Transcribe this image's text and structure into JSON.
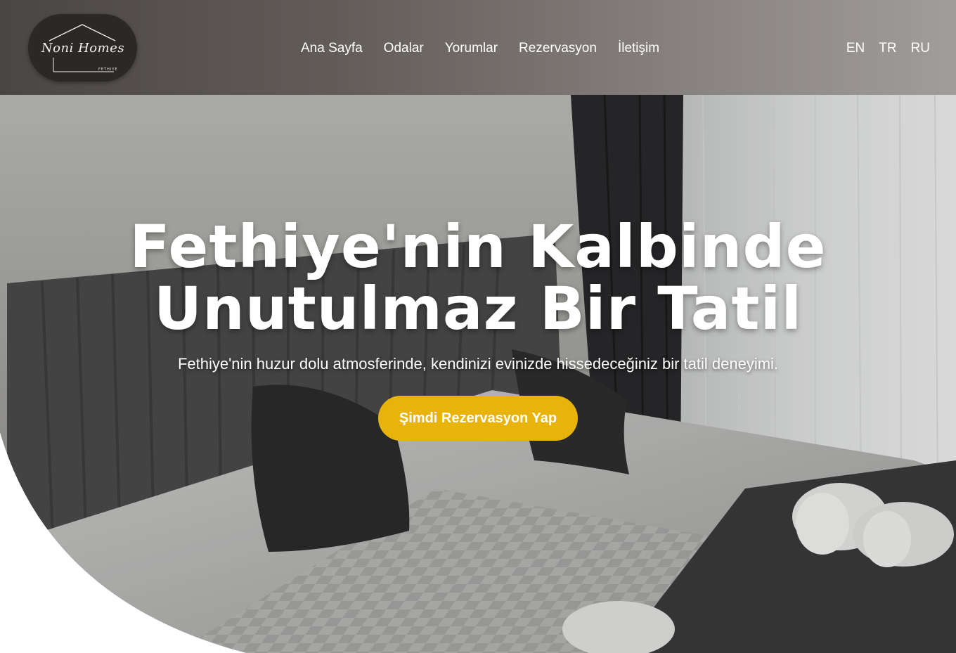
{
  "header": {
    "logo": {
      "script_text": "Noni Homes",
      "subtext": "FETHIYE"
    },
    "nav": [
      {
        "label": "Ana Sayfa"
      },
      {
        "label": "Odalar"
      },
      {
        "label": "Yorumlar"
      },
      {
        "label": "Rezervasyon"
      },
      {
        "label": "İletişim"
      }
    ],
    "languages": [
      {
        "label": "EN"
      },
      {
        "label": "TR"
      },
      {
        "label": "RU"
      }
    ]
  },
  "hero": {
    "title_line1": "Fethiye'nin Kalbinde",
    "title_line2": "Unutulmaz Bir Tatil",
    "subtitle": "Fethiye'nin huzur dolu atmosferinde, kendinizi evinizde hissedeceğiniz bir tatil deneyimi.",
    "cta_label": "Şimdi Rezervasyon Yap"
  },
  "colors": {
    "cta": "#e8b40c",
    "header_dark": "#4a4644",
    "header_light": "#a19d9a",
    "logo_bg": "#2b2928"
  }
}
